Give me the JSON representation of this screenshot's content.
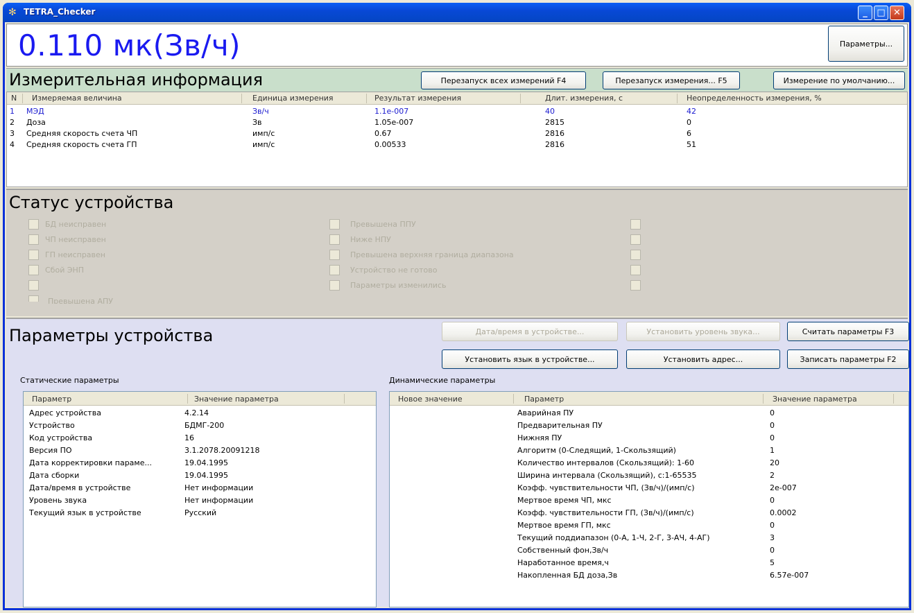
{
  "window": {
    "title": "TETRA_Checker",
    "min": "_",
    "max": "□",
    "close": "✕"
  },
  "dose": {
    "value": "0.110 мк(Зв/ч)",
    "params_button": "Параметры..."
  },
  "measurement": {
    "title": "Измерительная информация",
    "buttons": {
      "restart_all": "Перезапуск всех измерений F4",
      "restart_one": "Перезапуск измерения... F5",
      "default": "Измерение по умолчанию..."
    },
    "columns": [
      "N",
      "Измеряемая величина",
      "Единица измерения",
      "Результат измерения",
      "Длит. измерения, с",
      "Неопределенность измерения, %"
    ],
    "rows": [
      [
        "1",
        "МЭД",
        "Зв/ч",
        "1.1e-007",
        "40",
        "42"
      ],
      [
        "2",
        "Доза",
        "Зв",
        "1.05e-007",
        "2815",
        "0"
      ],
      [
        "3",
        "Средняя скорость счета ЧП",
        "имп/с",
        "0.67",
        "2816",
        "6"
      ],
      [
        "4",
        "Средняя скорость счета ГП",
        "имп/с",
        "0.00533",
        "2816",
        "51"
      ]
    ]
  },
  "status": {
    "title": "Статус устройства",
    "col1": [
      "БД неисправен",
      "ЧП неисправен",
      "ГП неисправен",
      "Сбой ЭНП",
      ""
    ],
    "col1_extra": "Превышена АПУ",
    "col2": [
      "Превышена ППУ",
      "Ниже НПУ",
      "Превышена верхняя граница диапазона",
      "Устройство не готово",
      "Параметры изменились"
    ],
    "col3": [
      "",
      "",
      "",
      "",
      ""
    ]
  },
  "device": {
    "title": "Параметры устройства",
    "buttons": {
      "datetime": "Дата/время в устройстве...",
      "sound": "Установить уровень звука...",
      "read": "Считать параметры F3",
      "language": "Установить язык в устройстве...",
      "address": "Установить адрес...",
      "write": "Записать параметры F2"
    },
    "static_label": "Статические параметры",
    "dynamic_label": "Динамические параметры",
    "static_columns": [
      "Параметр",
      "Значение параметра"
    ],
    "static_rows": [
      [
        "Адрес устройства",
        "4.2.14"
      ],
      [
        "Устройство",
        "БДМГ-200"
      ],
      [
        "Код устройства",
        "16"
      ],
      [
        "Версия ПО",
        "3.1.2078.20091218"
      ],
      [
        "Дата корректировки параме...",
        "19.04.1995"
      ],
      [
        "Дата сборки",
        "19.04.1995"
      ],
      [
        "Дата/время в устройстве",
        "Нет информации"
      ],
      [
        "Уровень звука",
        "Нет информации"
      ],
      [
        "Текущий язык в устройстве",
        "Русский"
      ]
    ],
    "dynamic_columns": [
      "Новое значение",
      "Параметр",
      "Значение параметра"
    ],
    "dynamic_rows": [
      [
        "Аварийная ПУ",
        "0"
      ],
      [
        "Предварительная ПУ",
        "0"
      ],
      [
        "Нижняя ПУ",
        "0"
      ],
      [
        "Алгоритм (0-Следящий, 1-Скользящий)",
        "1"
      ],
      [
        "Количество интервалов (Скользящий): 1-60",
        "20"
      ],
      [
        "Ширина интервала (Скользящий), с:1-65535",
        "2"
      ],
      [
        "Коэфф. чувствительности ЧП, (Зв/ч)/(имп/с)",
        "2e-007"
      ],
      [
        "Мертвое время ЧП, мкс",
        "0"
      ],
      [
        "Коэфф. чувствительности ГП, (Зв/ч)/(имп/с)",
        "0.0002"
      ],
      [
        "Мертвое время ГП, мкс",
        "0"
      ],
      [
        "Текущий поддиапазон (0-А, 1-Ч, 2-Г, 3-АЧ, 4-АГ)",
        "3"
      ],
      [
        "Собственный фон,Зв/ч",
        "0"
      ],
      [
        "Наработанное время,ч",
        "5"
      ],
      [
        "Накопленная БД доза,Зв",
        "6.57e-007"
      ]
    ]
  }
}
